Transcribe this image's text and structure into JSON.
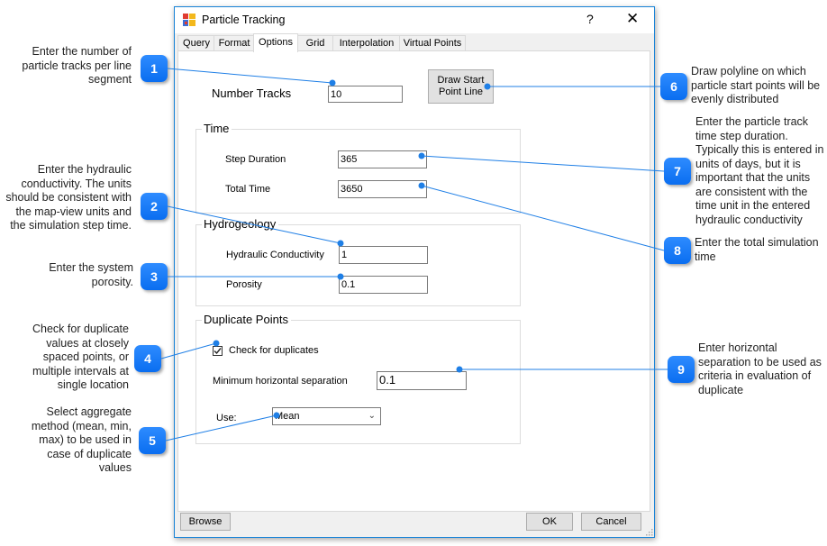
{
  "dialog": {
    "title": "Particle Tracking",
    "help_label": "?",
    "close_label": "✕",
    "tabs": [
      {
        "label": "Query",
        "active": false
      },
      {
        "label": "Format",
        "active": false
      },
      {
        "label": "Options",
        "active": true
      },
      {
        "label": "Grid",
        "active": false
      },
      {
        "label": "Interpolation",
        "active": false
      },
      {
        "label": "Virtual Points",
        "active": false
      }
    ],
    "options": {
      "number_tracks_label": "Number Tracks",
      "number_tracks_value": "10",
      "draw_start_button": "Draw Start Point Line",
      "time_group": {
        "legend": "Time",
        "step_duration_label": "Step Duration",
        "step_duration_value": "365",
        "total_time_label": "Total Time",
        "total_time_value": "3650"
      },
      "hydro_group": {
        "legend": "Hydrogeology",
        "conductivity_label": "Hydraulic Conductivity",
        "conductivity_value": "1",
        "porosity_label": "Porosity",
        "porosity_value": "0.1"
      },
      "duplicate_group": {
        "legend": "Duplicate Points",
        "check_label": "Check for duplicates",
        "checked": true,
        "min_sep_label": "Minimum horizontal separation",
        "min_sep_value": "0.1",
        "use_label": "Use:",
        "use_value": "Mean"
      }
    },
    "footer": {
      "browse": "Browse",
      "ok": "OK",
      "cancel": "Cancel"
    }
  },
  "annotations": [
    {
      "n": "1",
      "text": "Enter the number of particle tracks per line segment"
    },
    {
      "n": "2",
      "text": "Enter the hydraulic conductivity.  The units should be consistent with the map-view units and the simulation step time."
    },
    {
      "n": "3",
      "text": "Enter the system porosity."
    },
    {
      "n": "4",
      "text": "Check for duplicate values at closely spaced points, or multiple intervals at single location"
    },
    {
      "n": "5",
      "text": "Select aggregate method (mean, min, max) to be used in case of duplicate values"
    },
    {
      "n": "6",
      "text": "Draw polyline on which particle start points will be evenly distributed"
    },
    {
      "n": "7",
      "text": "Enter the particle track time step duration. Typically this is entered in units of days, but it is important that the units are consistent with the time unit in the entered hydraulic conductivity"
    },
    {
      "n": "8",
      "text": "Enter the total simulation time"
    },
    {
      "n": "9",
      "text": "Enter horizontal separation to be used as criteria in evaluation of duplicate"
    }
  ],
  "colors": {
    "accent": "#0a6ef0",
    "dialog_border": "#1883d7"
  }
}
